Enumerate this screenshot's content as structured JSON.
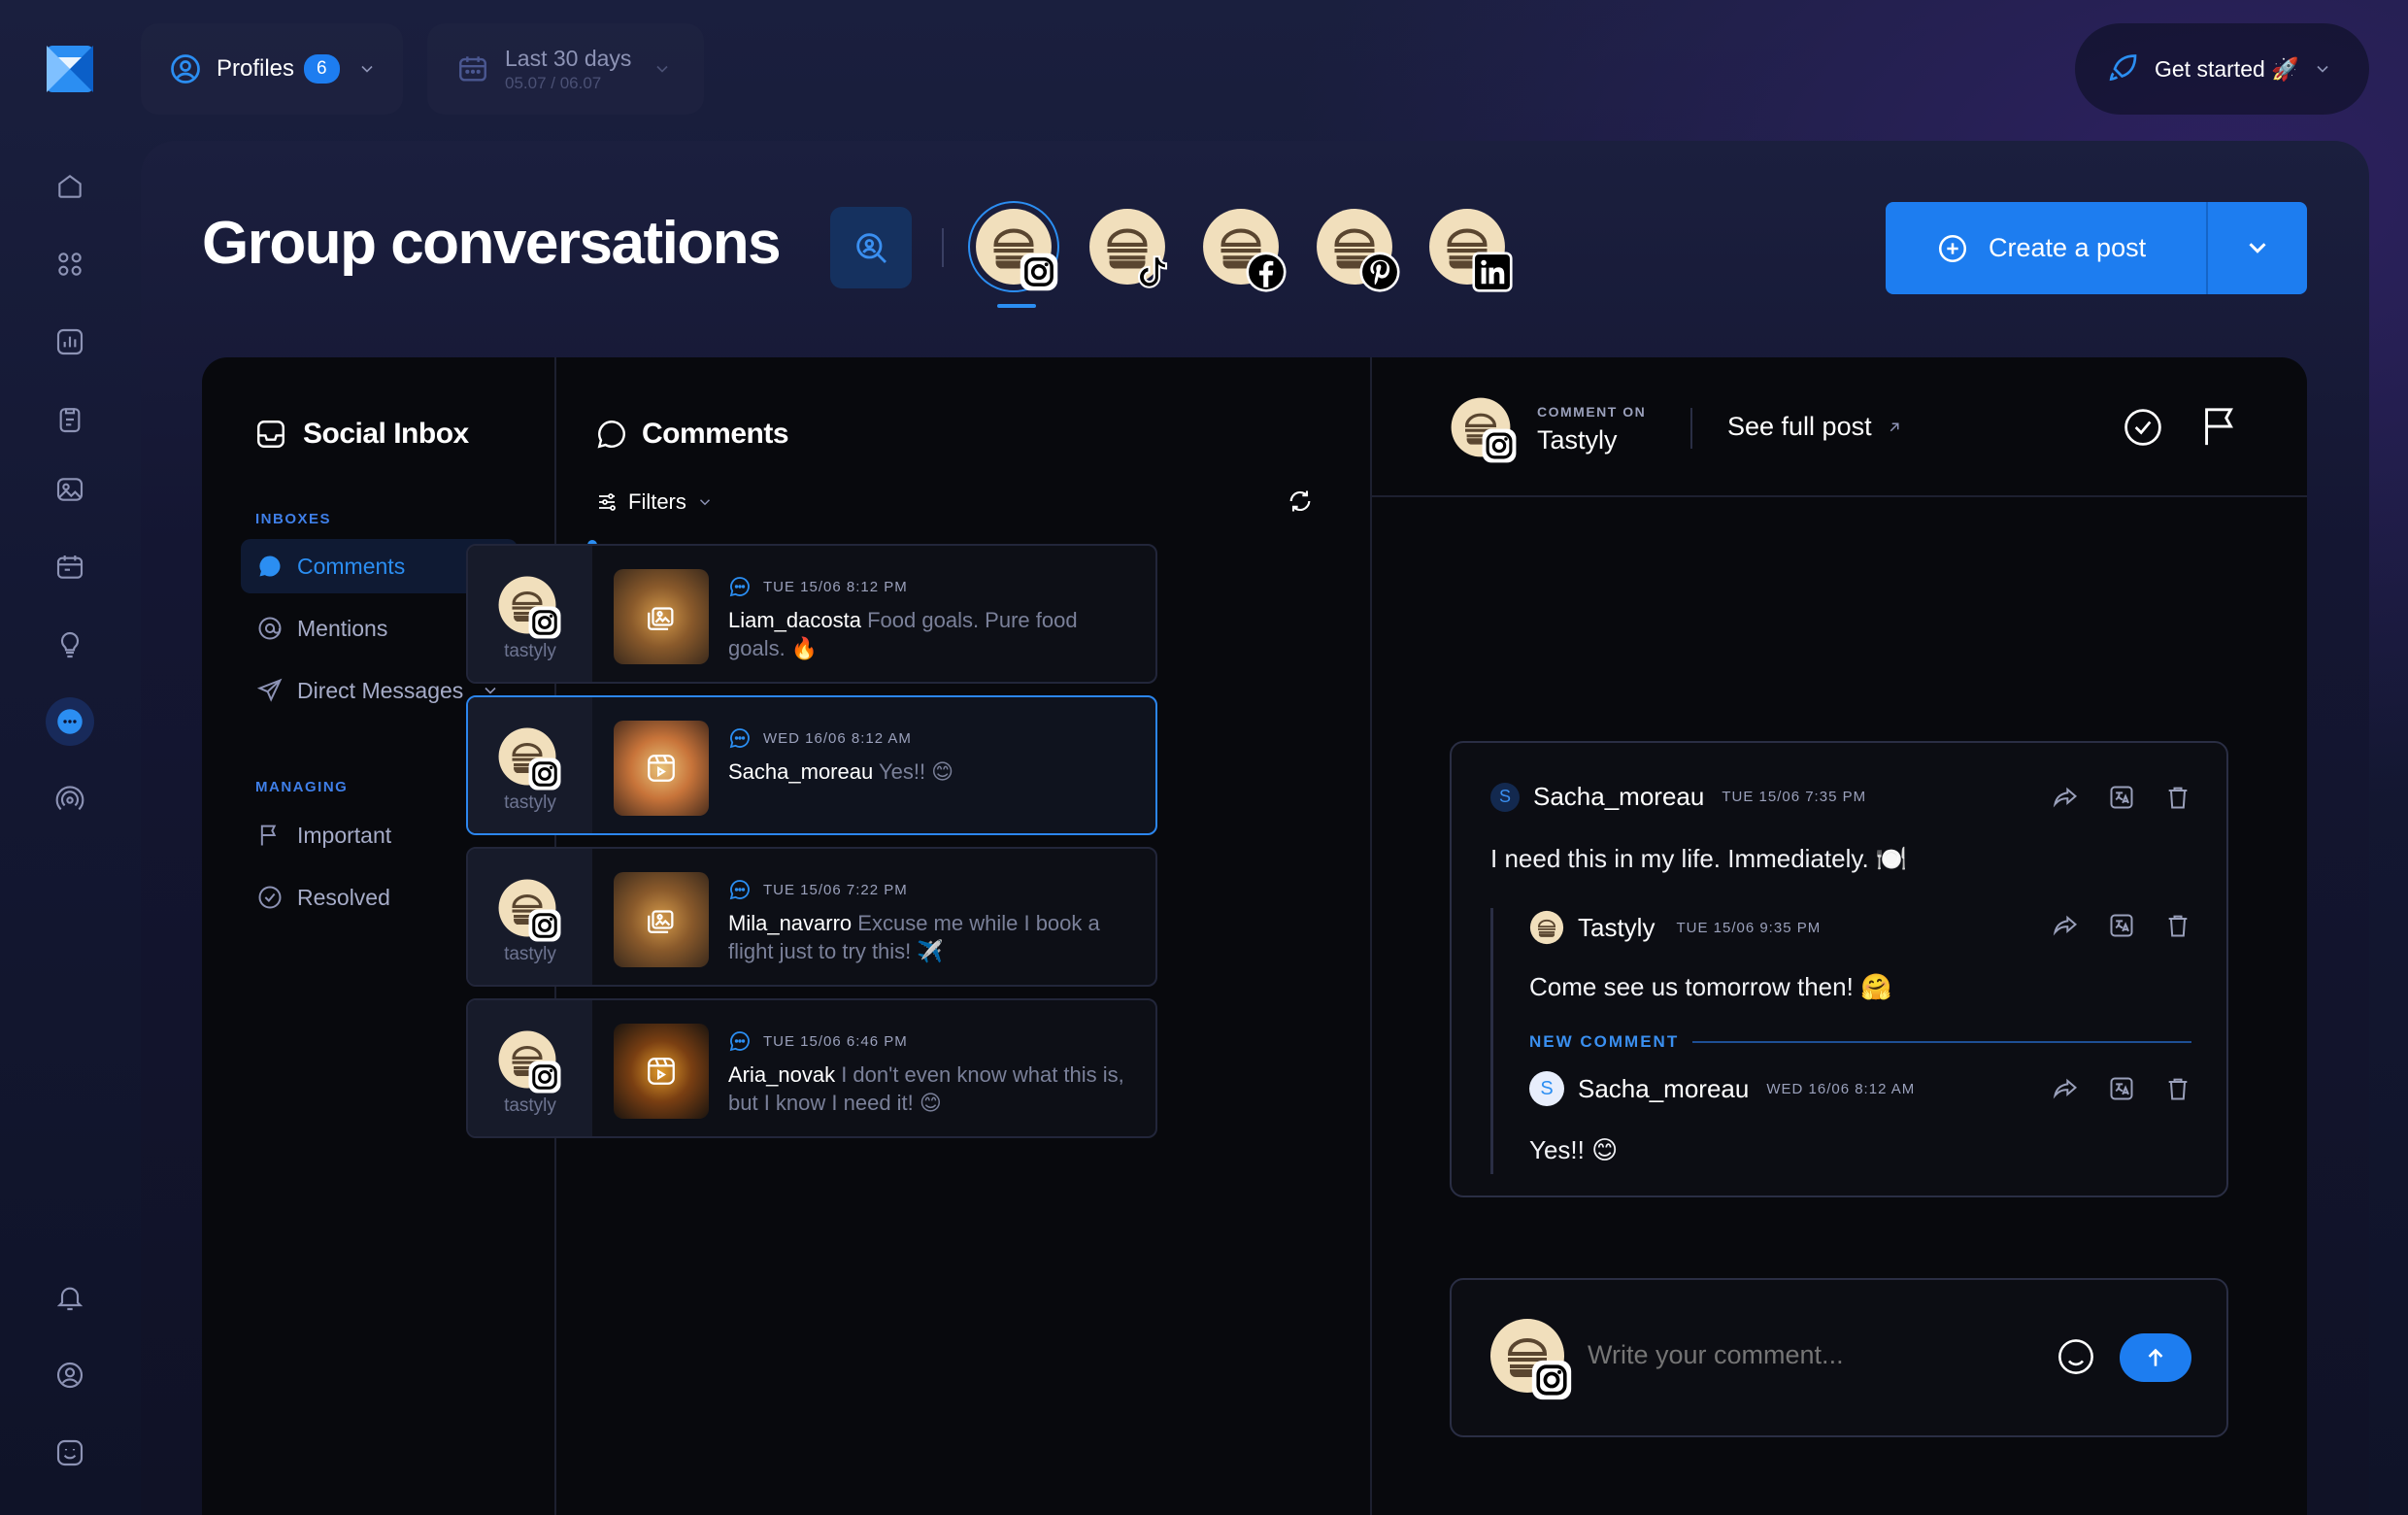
{
  "app": {
    "accent": "#1d8af0"
  },
  "topbar": {
    "profiles_label": "Profiles",
    "profiles_count": "6",
    "date_label": "Last 30 days",
    "date_range": "05.07 / 06.07",
    "get_started_label": "Get started 🚀"
  },
  "page": {
    "title": "Group conversations",
    "create_post_label": "Create a post"
  },
  "profile_icons": [
    "instagram-icon",
    "tiktok-icon",
    "facebook-icon",
    "pinterest-icon",
    "linkedin-icon"
  ],
  "inbox": {
    "title": "Social Inbox",
    "inboxes_caption": "INBOXES",
    "items": [
      {
        "label": "Comments"
      },
      {
        "label": "Mentions"
      },
      {
        "label": "Direct Messages"
      }
    ],
    "managing_caption": "MANAGING",
    "managing": [
      {
        "label": "Important"
      },
      {
        "label": "Resolved"
      }
    ]
  },
  "comments": {
    "title": "Comments",
    "filters_label": "Filters",
    "items": [
      {
        "account": "tastyly",
        "time": "TUE 15/06 8:12 PM",
        "user": "Liam_dacosta",
        "text": "Food goals. Pure food goals. 🔥"
      },
      {
        "account": "tastyly",
        "time": "WED 16/06 8:12 AM",
        "user": "Sacha_moreau",
        "text": "Yes!! 😊"
      },
      {
        "account": "tastyly",
        "time": "TUE 15/06 7:22 PM",
        "user": "Mila_navarro",
        "text": "Excuse me while I book a flight just to try this! ✈️"
      },
      {
        "account": "tastyly",
        "time": "TUE 15/06 6:46 PM",
        "user": "Aria_novak",
        "text": "I don't even know what this is, but I know I need it! 😊"
      }
    ]
  },
  "detail": {
    "comment_on_caption": "COMMENT ON",
    "account": "Tastyly",
    "see_full_post": "See full post",
    "thread": {
      "root": {
        "initial": "S",
        "user": "Sacha_moreau",
        "time": "TUE 15/06 7:35 PM",
        "text": "I need this in my life. Immediately. 🍽️"
      },
      "reply": {
        "user": "Tastyly",
        "time": "TUE 15/06 9:35 PM",
        "text": "Come see us tomorrow then! 🤗"
      },
      "new_comment_caption": "NEW COMMENT",
      "new": {
        "initial": "S",
        "user": "Sacha_moreau",
        "time": "WED 16/06 8:12 AM",
        "text": "Yes!! 😊"
      }
    },
    "composer": {
      "placeholder": "Write your comment..."
    }
  }
}
